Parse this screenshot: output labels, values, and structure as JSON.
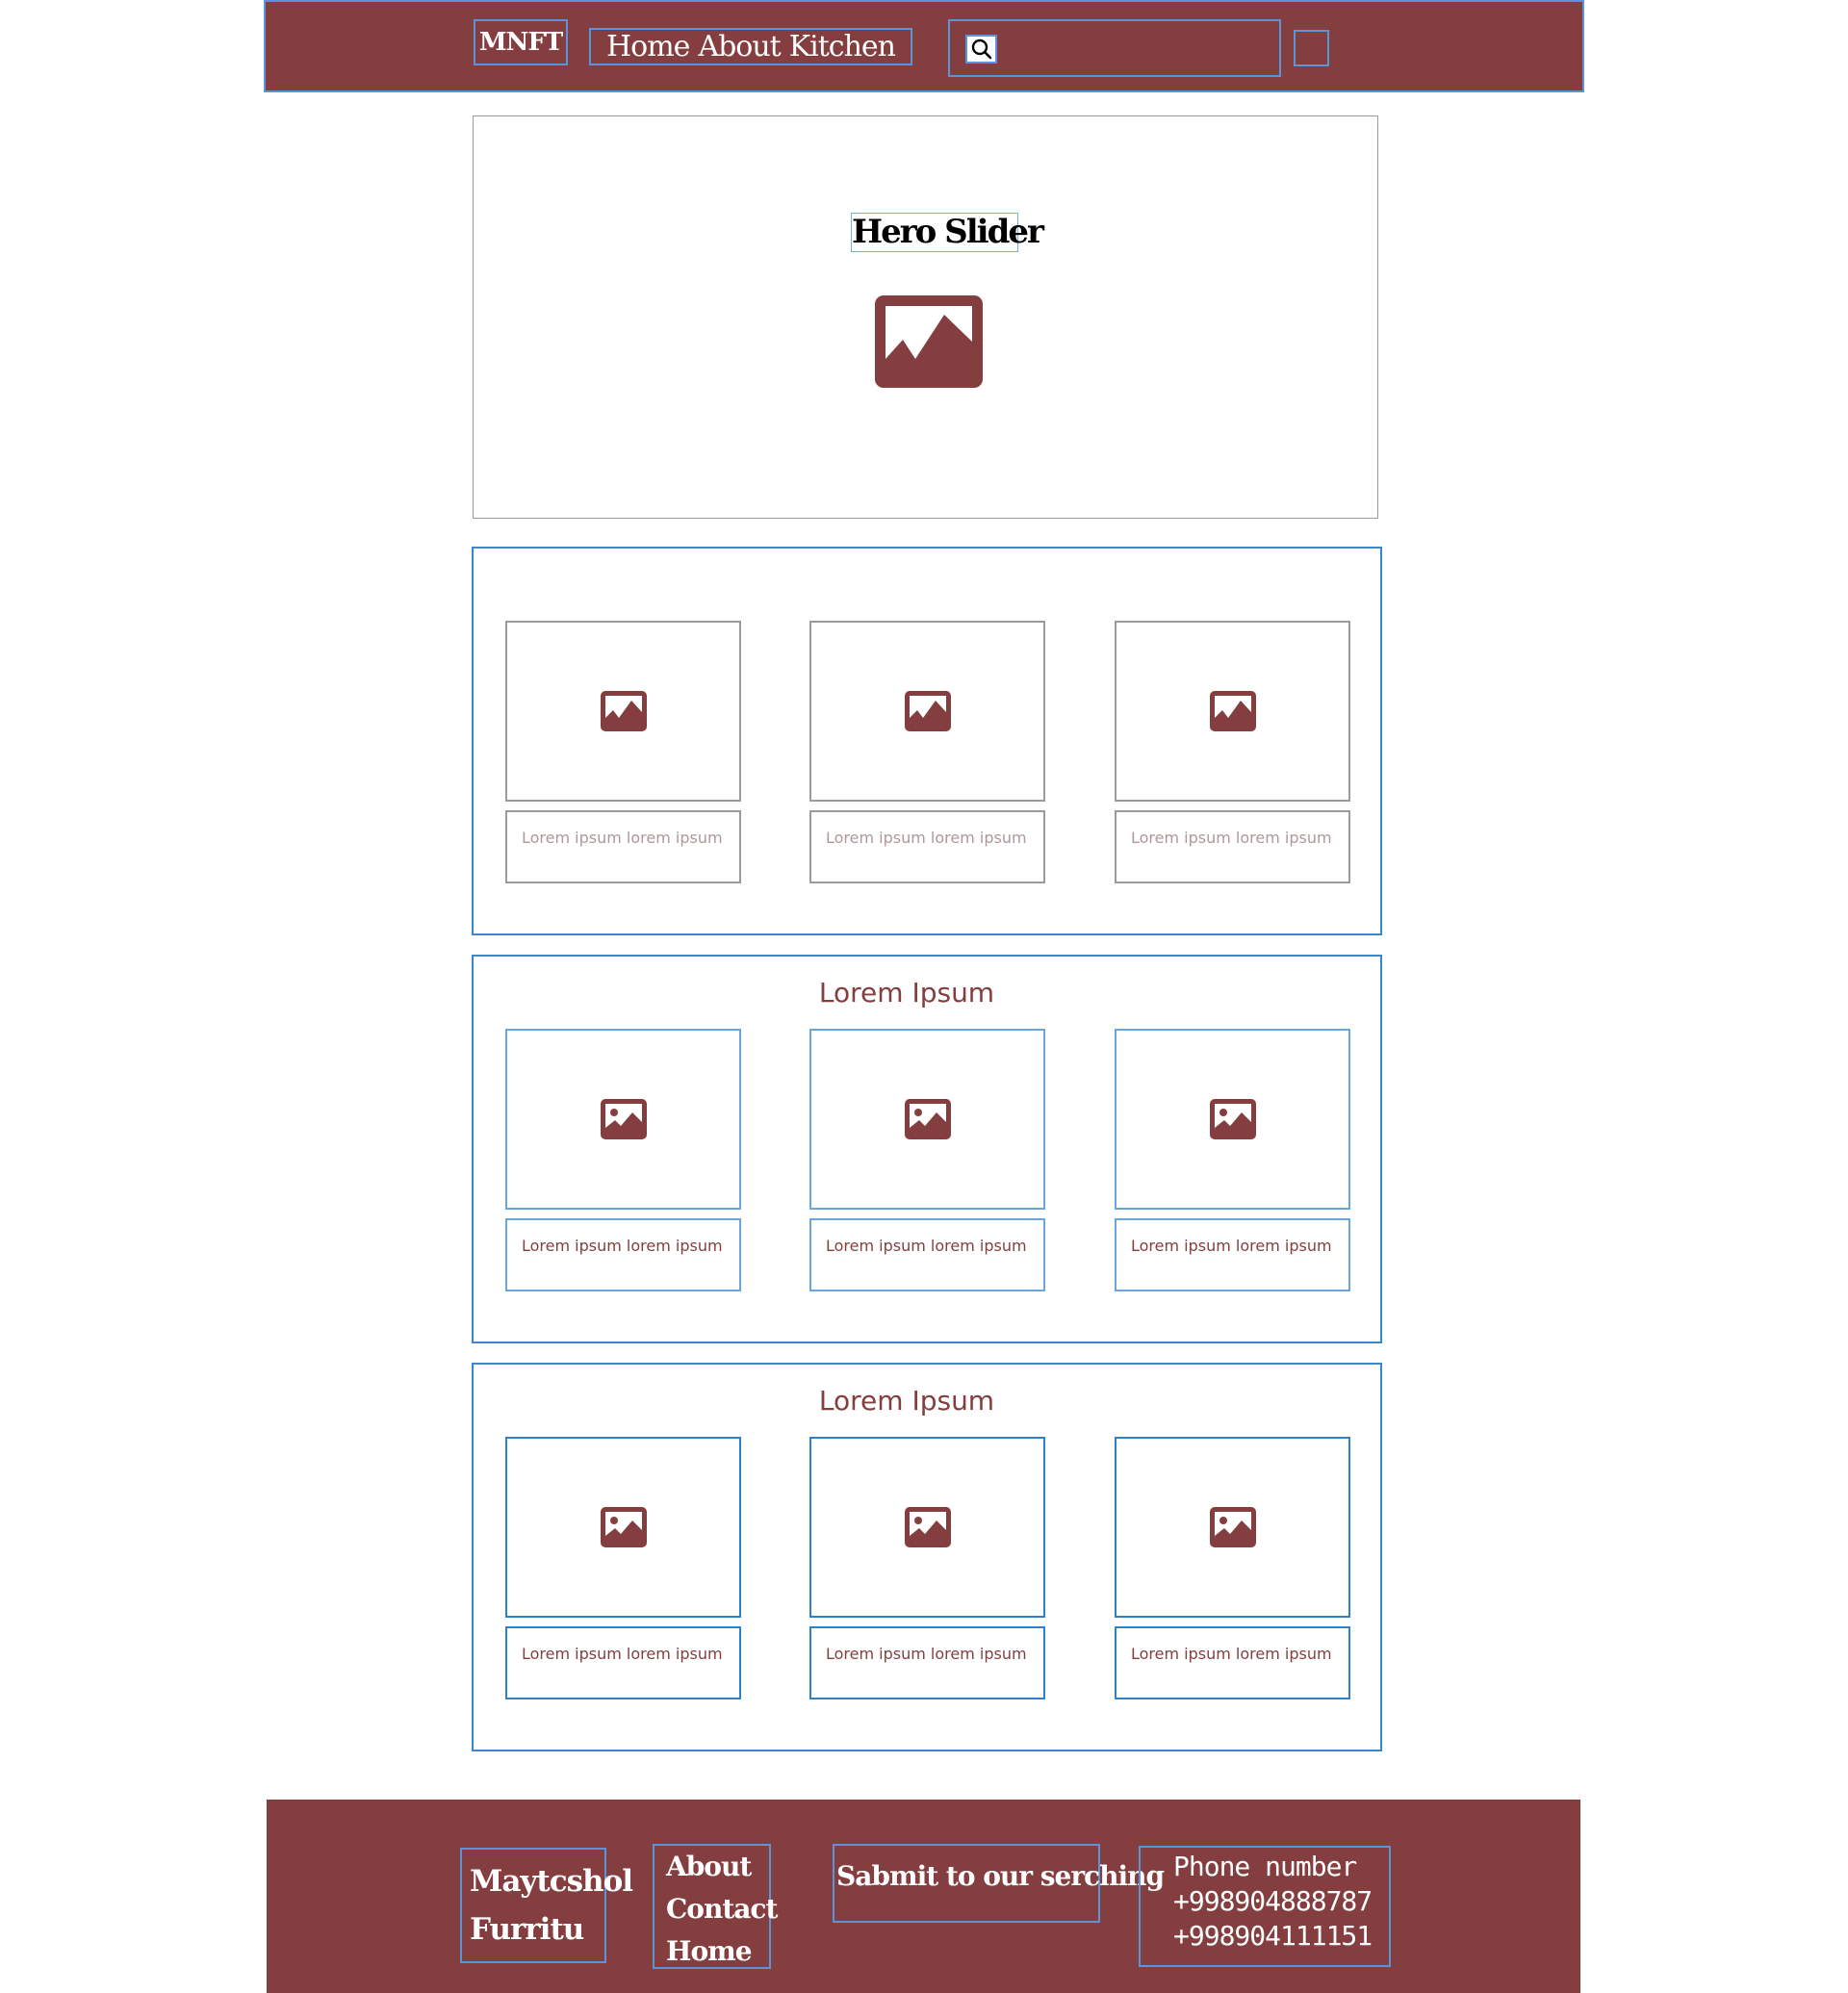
{
  "header": {
    "brand": "MNFT",
    "nav": [
      "Home",
      "About",
      "Kitchen"
    ],
    "search_placeholder": "",
    "search_icon": "search-icon"
  },
  "hero": {
    "title": "Hero Slider",
    "image_icon": "image-icon"
  },
  "sections": [
    {
      "title": "",
      "cards": [
        {
          "caption": "Lorem ipsum lorem ipsum"
        },
        {
          "caption": "Lorem ipsum lorem ipsum"
        },
        {
          "caption": "Lorem ipsum lorem ipsum"
        }
      ]
    },
    {
      "title": "Lorem Ipsum",
      "cards": [
        {
          "caption": "Lorem ipsum lorem ipsum"
        },
        {
          "caption": "Lorem ipsum lorem ipsum"
        },
        {
          "caption": "Lorem ipsum lorem ipsum"
        }
      ]
    },
    {
      "title": "Lorem Ipsum",
      "cards": [
        {
          "caption": "Lorem ipsum lorem ipsum"
        },
        {
          "caption": "Lorem ipsum lorem ipsum"
        },
        {
          "caption": "Lorem ipsum lorem ipsum"
        }
      ]
    }
  ],
  "footer": {
    "brand_lines": [
      "Maytcshol",
      "Furritu"
    ],
    "links": [
      "About",
      "Contact",
      "Home"
    ],
    "submit": "Sabmit to our serching",
    "phone_label": "Phone number",
    "phones": [
      "+998904888787",
      "+998904111151"
    ]
  },
  "colors": {
    "brand": "#843e3f",
    "wire_border": "#3b87c9",
    "background": "#ffffff"
  }
}
